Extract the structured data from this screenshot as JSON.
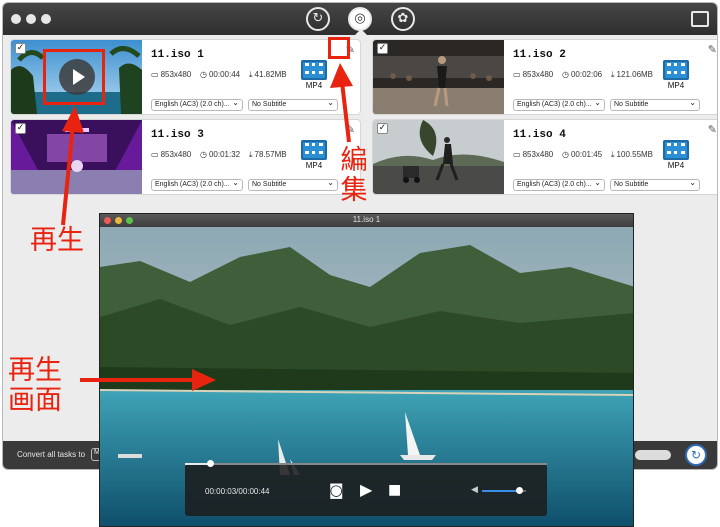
{
  "toolbar": {
    "tab_icons": [
      {
        "name": "convert-tab-icon",
        "glyph": "↻"
      },
      {
        "name": "burn-tab-icon",
        "glyph": "◎"
      },
      {
        "name": "toolbox-tab-icon",
        "glyph": "✿"
      }
    ],
    "right_icon": "media-folder-icon"
  },
  "tasks": [
    {
      "title": "11.iso 1",
      "resolution": "853x480",
      "duration": "00:00:44",
      "size": "41.82MB",
      "format": "MP4",
      "audio": "English (AC3) (2.0 ch)...",
      "subtitle": "No Subtitle",
      "checked": true
    },
    {
      "title": "11.iso 2",
      "resolution": "853x480",
      "duration": "00:02:06",
      "size": "121.06MB",
      "format": "MP4",
      "audio": "English (AC3) (2.0 ch)...",
      "subtitle": "No Subtitle",
      "checked": true
    },
    {
      "title": "11.iso 3",
      "resolution": "853x480",
      "duration": "00:01:32",
      "size": "78.57MB",
      "format": "MP4",
      "audio": "English (AC3) (2.0 ch)...",
      "subtitle": "No Subtitle",
      "checked": true
    },
    {
      "title": "11.iso 4",
      "resolution": "853x480",
      "duration": "00:01:45",
      "size": "100.55MB",
      "format": "MP4",
      "audio": "English (AC3) (2.0 ch)...",
      "subtitle": "No Subtitle",
      "checked": true
    }
  ],
  "bottom": {
    "convert_label": "Convert all tasks to",
    "convert_value": "M"
  },
  "player": {
    "title": "11.iso 1",
    "time": "00:00:03/00:00:44",
    "progress": 0.07,
    "volume": 0.85
  },
  "annotations": {
    "edit": "編\n集",
    "play": "再生",
    "screen_line1": "再生",
    "screen_line2": "画面"
  },
  "colors": {
    "annotation": "#e8230f",
    "titlebar": "#3a3a3a",
    "volume_accent": "#3b8ee8",
    "format_icon": "#2b8fd6"
  }
}
